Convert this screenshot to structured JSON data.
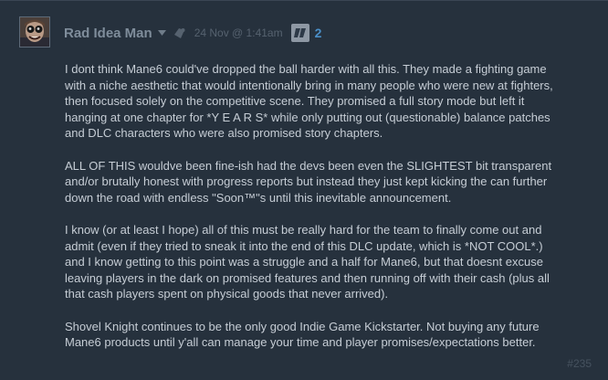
{
  "comment": {
    "author": "Rad Idea Man",
    "timestamp": "24 Nov @ 1:41am",
    "badge_count": "2",
    "index": "#235",
    "paragraphs": [
      "I dont think Mane6 could've dropped the ball harder with all this. They made a fighting game\nwith a niche aesthetic that would intentionally bring in many people who were new at fighters,\nthen focused solely on the competitive scene. They promised a full story mode but left it\nhanging at one chapter for *Y E A R S* while only putting out (questionable) balance patches\nand DLC characters who were also promised story chapters.",
      "ALL OF THIS wouldve been fine-ish had the devs been even the SLIGHTEST bit transparent\nand/or brutally honest with progress reports but instead they just kept kicking the can further\ndown the road with endless \"Soon™\"s until this inevitable announcement.",
      "I know (or at least I hope) all of this must be really hard for the team to finally come out and\nadmit (even if they tried to sneak it into the end of this DLC update, which is *NOT COOL*.)\nand I know getting to this point was a struggle and a half for Mane6, but that doesnt excuse\nleaving players in the dark on promised features and then running off with their cash (plus all\nthat cash players spent on physical goods that never arrived).",
      "Shovel Knight continues to be the only good Indie Game Kickstarter. Not buying any future\nMane6 products until y'all can manage your time and player promises/expectations better."
    ]
  },
  "icons": {
    "dropdown": "chevron-down-icon",
    "award": "award-icon",
    "badge": "community-badge-icon"
  },
  "colors": {
    "background": "#26313d",
    "author": "#7f8d9b",
    "text": "#c6cdd5",
    "badge_count": "#4a8fc8"
  }
}
